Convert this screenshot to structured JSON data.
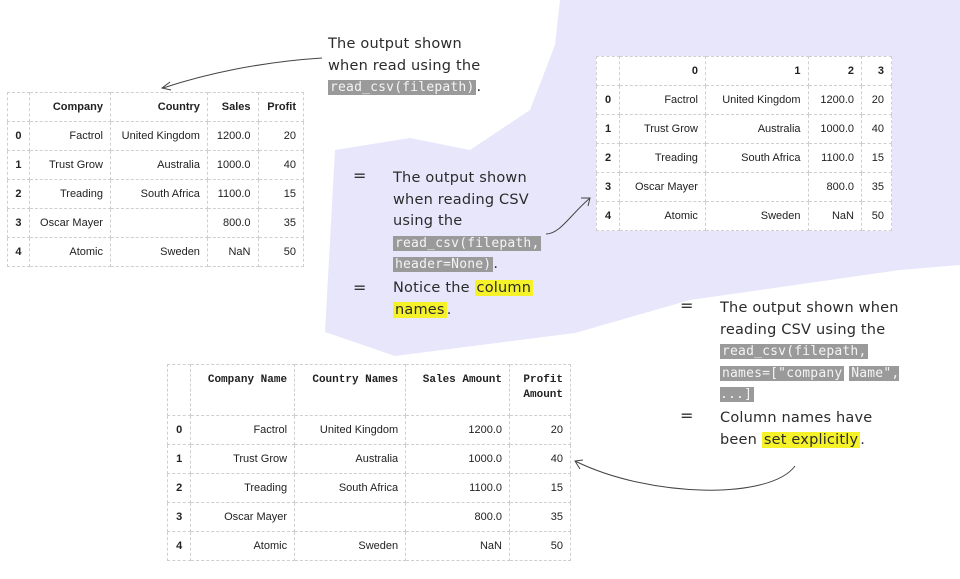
{
  "note_top": {
    "text": "The output shown when read using the",
    "code": "read_csv(filepath)",
    "tail": "."
  },
  "note_middle": {
    "bullet1_text": "The output shown when reading CSV using the",
    "bullet1_code1": "read_csv(filepath,",
    "bullet1_code2": "header=None)",
    "bullet1_tail": ".",
    "bullet2_text": "Notice the",
    "bullet2_highlight1": "column",
    "bullet2_highlight2": "names",
    "bullet2_tail": "."
  },
  "note_right": {
    "bullet1_text": "The output shown when reading CSV using the",
    "bullet1_code1": "read_csv(filepath,",
    "bullet1_code2": "names=[\"company",
    "bullet1_code3": "Name\", ...]",
    "bullet2_text": "Column names have been",
    "bullet2_highlight": "set explicitly",
    "bullet2_tail": "."
  },
  "bullet_symbol": "=",
  "table_default": {
    "columns": [
      "",
      "Company",
      "Country",
      "Sales",
      "Profit"
    ],
    "rows": [
      [
        "0",
        "Factrol",
        "United Kingdom",
        "1200.0",
        "20"
      ],
      [
        "1",
        "Trust Grow",
        "Australia",
        "1000.0",
        "40"
      ],
      [
        "2",
        "Treading",
        "South Africa",
        "1100.0",
        "15"
      ],
      [
        "3",
        "Oscar Mayer",
        "",
        "800.0",
        "35"
      ],
      [
        "4",
        "Atomic",
        "Sweden",
        "NaN",
        "50"
      ]
    ]
  },
  "table_no_header": {
    "columns": [
      "",
      "0",
      "1",
      "2",
      "3"
    ],
    "rows": [
      [
        "0",
        "Factrol",
        "United Kingdom",
        "1200.0",
        "20"
      ],
      [
        "1",
        "Trust Grow",
        "Australia",
        "1000.0",
        "40"
      ],
      [
        "2",
        "Treading",
        "South Africa",
        "1100.0",
        "15"
      ],
      [
        "3",
        "Oscar Mayer",
        "",
        "800.0",
        "35"
      ],
      [
        "4",
        "Atomic",
        "Sweden",
        "NaN",
        "50"
      ]
    ]
  },
  "table_named": {
    "columns": [
      "",
      "Company Name",
      "Country Names",
      "Sales Amount",
      "Profit Amount"
    ],
    "rows": [
      [
        "0",
        "Factrol",
        "United Kingdom",
        "1200.0",
        "20"
      ],
      [
        "1",
        "Trust Grow",
        "Australia",
        "1000.0",
        "40"
      ],
      [
        "2",
        "Treading",
        "South Africa",
        "1100.0",
        "15"
      ],
      [
        "3",
        "Oscar Mayer",
        "",
        "800.0",
        "35"
      ],
      [
        "4",
        "Atomic",
        "Sweden",
        "NaN",
        "50"
      ]
    ]
  },
  "colors": {
    "panel": "#e8e6fb",
    "code_bg": "#9a9a9a",
    "highlight": "#f5f22a",
    "grid": "#cfcfcf"
  }
}
